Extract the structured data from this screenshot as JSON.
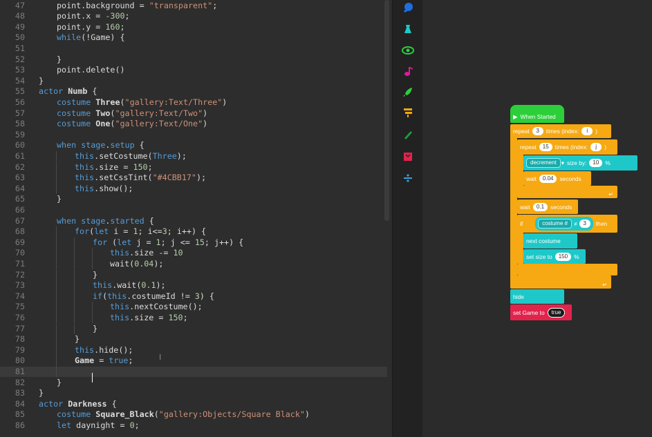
{
  "editor": {
    "lines": [
      {
        "n": "47",
        "i": 2,
        "t": [
          {
            "c": "id",
            "v": "point.background = "
          },
          {
            "c": "str",
            "v": "\"transparent\""
          },
          {
            "c": "id",
            "v": ";"
          }
        ]
      },
      {
        "n": "48",
        "i": 2,
        "t": [
          {
            "c": "id",
            "v": "point.x = "
          },
          {
            "c": "num",
            "v": "-300"
          },
          {
            "c": "id",
            "v": ";"
          }
        ]
      },
      {
        "n": "49",
        "i": 2,
        "t": [
          {
            "c": "id",
            "v": "point.y = "
          },
          {
            "c": "num",
            "v": "160"
          },
          {
            "c": "id",
            "v": ";"
          }
        ]
      },
      {
        "n": "50",
        "i": 2,
        "t": [
          {
            "c": "kw",
            "v": "while"
          },
          {
            "c": "id",
            "v": "(!Game) {"
          }
        ]
      },
      {
        "n": "51",
        "i": 2,
        "t": []
      },
      {
        "n": "52",
        "i": 2,
        "t": [
          {
            "c": "id",
            "v": "}"
          }
        ]
      },
      {
        "n": "53",
        "i": 2,
        "t": [
          {
            "c": "id",
            "v": "point.delete()"
          }
        ]
      },
      {
        "n": "54",
        "i": 1,
        "t": [
          {
            "c": "id",
            "v": "}"
          }
        ]
      },
      {
        "n": "55",
        "i": 1,
        "t": [
          {
            "c": "kw",
            "v": "actor "
          },
          {
            "c": "cls",
            "v": "Numb"
          },
          {
            "c": "id",
            "v": " {"
          }
        ]
      },
      {
        "n": "56",
        "i": 2,
        "t": [
          {
            "c": "kw",
            "v": "costume "
          },
          {
            "c": "cls",
            "v": "Three"
          },
          {
            "c": "id",
            "v": "("
          },
          {
            "c": "str",
            "v": "\"gallery:Text/Three\""
          },
          {
            "c": "id",
            "v": ")"
          }
        ]
      },
      {
        "n": "57",
        "i": 2,
        "t": [
          {
            "c": "kw",
            "v": "costume "
          },
          {
            "c": "cls",
            "v": "Two"
          },
          {
            "c": "id",
            "v": "("
          },
          {
            "c": "str",
            "v": "\"gallery:Text/Two\""
          },
          {
            "c": "id",
            "v": ")"
          }
        ]
      },
      {
        "n": "58",
        "i": 2,
        "t": [
          {
            "c": "kw",
            "v": "costume "
          },
          {
            "c": "cls",
            "v": "One"
          },
          {
            "c": "id",
            "v": "("
          },
          {
            "c": "str",
            "v": "\"gallery:Text/One\""
          },
          {
            "c": "id",
            "v": ")"
          }
        ]
      },
      {
        "n": "59",
        "i": 2,
        "t": []
      },
      {
        "n": "60",
        "i": 2,
        "t": [
          {
            "c": "kw",
            "v": "when "
          },
          {
            "c": "kw",
            "v": "stage"
          },
          {
            "c": "id",
            "v": "."
          },
          {
            "c": "kw",
            "v": "setup"
          },
          {
            "c": "id",
            "v": " {"
          }
        ]
      },
      {
        "n": "61",
        "i": 3,
        "t": [
          {
            "c": "kw",
            "v": "this"
          },
          {
            "c": "id",
            "v": ".setCostume("
          },
          {
            "c": "kw",
            "v": "Three"
          },
          {
            "c": "id",
            "v": ");"
          }
        ]
      },
      {
        "n": "62",
        "i": 3,
        "t": [
          {
            "c": "kw",
            "v": "this"
          },
          {
            "c": "id",
            "v": ".size = "
          },
          {
            "c": "num",
            "v": "150"
          },
          {
            "c": "id",
            "v": ";"
          }
        ]
      },
      {
        "n": "63",
        "i": 3,
        "t": [
          {
            "c": "kw",
            "v": "this"
          },
          {
            "c": "id",
            "v": ".setCssTint("
          },
          {
            "c": "str",
            "v": "\"#4CBB17\""
          },
          {
            "c": "id",
            "v": ");"
          }
        ]
      },
      {
        "n": "64",
        "i": 3,
        "t": [
          {
            "c": "kw",
            "v": "this"
          },
          {
            "c": "id",
            "v": ".show();"
          }
        ]
      },
      {
        "n": "65",
        "i": 2,
        "t": [
          {
            "c": "id",
            "v": "}"
          }
        ]
      },
      {
        "n": "66",
        "i": 2,
        "t": []
      },
      {
        "n": "67",
        "i": 2,
        "t": [
          {
            "c": "kw",
            "v": "when "
          },
          {
            "c": "kw",
            "v": "stage"
          },
          {
            "c": "id",
            "v": "."
          },
          {
            "c": "kw",
            "v": "started"
          },
          {
            "c": "id",
            "v": " {"
          }
        ]
      },
      {
        "n": "68",
        "i": 3,
        "t": [
          {
            "c": "kw",
            "v": "for"
          },
          {
            "c": "id",
            "v": "("
          },
          {
            "c": "kw",
            "v": "let"
          },
          {
            "c": "id",
            "v": " i = "
          },
          {
            "c": "num",
            "v": "1"
          },
          {
            "c": "id",
            "v": "; i<="
          },
          {
            "c": "num",
            "v": "3"
          },
          {
            "c": "id",
            "v": "; i++) {"
          }
        ]
      },
      {
        "n": "69",
        "i": 4,
        "t": [
          {
            "c": "kw",
            "v": "for"
          },
          {
            "c": "id",
            "v": " ("
          },
          {
            "c": "kw",
            "v": "let"
          },
          {
            "c": "id",
            "v": " j = "
          },
          {
            "c": "num",
            "v": "1"
          },
          {
            "c": "id",
            "v": "; j <= "
          },
          {
            "c": "num",
            "v": "15"
          },
          {
            "c": "id",
            "v": "; j++) {"
          }
        ]
      },
      {
        "n": "70",
        "i": 5,
        "t": [
          {
            "c": "kw",
            "v": "this"
          },
          {
            "c": "id",
            "v": ".size -= "
          },
          {
            "c": "num",
            "v": "10"
          }
        ]
      },
      {
        "n": "71",
        "i": 5,
        "t": [
          {
            "c": "id",
            "v": "wait("
          },
          {
            "c": "num",
            "v": "0.04"
          },
          {
            "c": "id",
            "v": ");"
          }
        ]
      },
      {
        "n": "72",
        "i": 4,
        "t": [
          {
            "c": "id",
            "v": "}"
          }
        ]
      },
      {
        "n": "73",
        "i": 4,
        "t": [
          {
            "c": "kw",
            "v": "this"
          },
          {
            "c": "id",
            "v": ".wait("
          },
          {
            "c": "num",
            "v": "0.1"
          },
          {
            "c": "id",
            "v": ");"
          }
        ]
      },
      {
        "n": "74",
        "i": 4,
        "t": [
          {
            "c": "kw",
            "v": "if"
          },
          {
            "c": "id",
            "v": "("
          },
          {
            "c": "kw",
            "v": "this"
          },
          {
            "c": "id",
            "v": ".costumeId != "
          },
          {
            "c": "num",
            "v": "3"
          },
          {
            "c": "id",
            "v": ") {"
          }
        ]
      },
      {
        "n": "75",
        "i": 5,
        "t": [
          {
            "c": "kw",
            "v": "this"
          },
          {
            "c": "id",
            "v": ".nextCostume();"
          }
        ]
      },
      {
        "n": "76",
        "i": 5,
        "t": [
          {
            "c": "kw",
            "v": "this"
          },
          {
            "c": "id",
            "v": ".size = "
          },
          {
            "c": "num",
            "v": "150"
          },
          {
            "c": "id",
            "v": ";"
          }
        ]
      },
      {
        "n": "77",
        "i": 4,
        "t": [
          {
            "c": "id",
            "v": "}"
          }
        ]
      },
      {
        "n": "78",
        "i": 3,
        "t": [
          {
            "c": "id",
            "v": "}"
          }
        ]
      },
      {
        "n": "79",
        "i": 3,
        "t": [
          {
            "c": "kw",
            "v": "this"
          },
          {
            "c": "id",
            "v": ".hide();"
          }
        ]
      },
      {
        "n": "80",
        "i": 3,
        "t": [
          {
            "c": "cls",
            "v": "Game"
          },
          {
            "c": "id",
            "v": " = "
          },
          {
            "c": "kw",
            "v": "true"
          },
          {
            "c": "id",
            "v": ";"
          }
        ]
      },
      {
        "n": "81",
        "i": 3,
        "t": [],
        "active": true
      },
      {
        "n": "82",
        "i": 2,
        "t": [
          {
            "c": "id",
            "v": "}"
          }
        ]
      },
      {
        "n": "83",
        "i": 1,
        "t": [
          {
            "c": "id",
            "v": "}"
          }
        ]
      },
      {
        "n": "84",
        "i": 1,
        "t": [
          {
            "c": "kw",
            "v": "actor "
          },
          {
            "c": "cls",
            "v": "Darkness"
          },
          {
            "c": "id",
            "v": " {"
          }
        ]
      },
      {
        "n": "85",
        "i": 2,
        "t": [
          {
            "c": "kw",
            "v": "costume "
          },
          {
            "c": "cls",
            "v": "Square_Black"
          },
          {
            "c": "id",
            "v": "("
          },
          {
            "c": "str",
            "v": "\"gallery:Objects/Square Black\""
          },
          {
            "c": "id",
            "v": ")"
          }
        ]
      },
      {
        "n": "86",
        "i": 2,
        "t": [
          {
            "c": "kw",
            "v": "let"
          },
          {
            "c": "id",
            "v": " daynight = "
          },
          {
            "c": "num",
            "v": "0"
          },
          {
            "c": "id",
            "v": ";"
          }
        ]
      }
    ],
    "colors": {
      "keyword": "#569cd6",
      "string": "#ce9178",
      "number": "#b5cea8",
      "text": "#dcdcdc"
    }
  },
  "palette": {
    "items": [
      {
        "icon": "actor-icon",
        "color": "#1e6fe0"
      },
      {
        "icon": "costume-icon",
        "color": "#1ec8c8"
      },
      {
        "icon": "looks-eye-icon",
        "color": "#2ccf3a"
      },
      {
        "icon": "music-note-icon",
        "color": "#e0189a"
      },
      {
        "icon": "rocket-icon",
        "color": "#2ccf3a"
      },
      {
        "icon": "control-flow-icon",
        "color": "#f6a912"
      },
      {
        "icon": "pencil-icon",
        "color": "#1f9e3a"
      },
      {
        "icon": "variable-box-icon",
        "color": "#e2234c"
      },
      {
        "icon": "operators-divide-icon",
        "color": "#3aa0d8"
      }
    ]
  },
  "blocks": {
    "hat": "When Started",
    "repeat_outer": {
      "label": "repeat",
      "count": "3",
      "times_label": "times (index:",
      "index": "i",
      "close": ")"
    },
    "repeat_inner": {
      "label": "repeat",
      "count": "15",
      "times_label": "times (index:",
      "index": "j",
      "close": ")"
    },
    "decrement": {
      "option": "decrement",
      "by_label": "size by:",
      "value": "10",
      "unit": "%"
    },
    "wait_inner": {
      "label": "wait",
      "value": "0.04",
      "unit": "seconds"
    },
    "wait_outer": {
      "label": "wait",
      "value": "0.1",
      "unit": "seconds"
    },
    "if_block": {
      "label": "if",
      "field": "costume #",
      "op": "≠",
      "value": "3",
      "then": "then"
    },
    "next_costume": "next costume",
    "set_size": {
      "label": "set  size to",
      "value": "150",
      "unit": "%"
    },
    "hide": "hide",
    "set_game": {
      "label": "set  Game to",
      "value": "true"
    }
  }
}
